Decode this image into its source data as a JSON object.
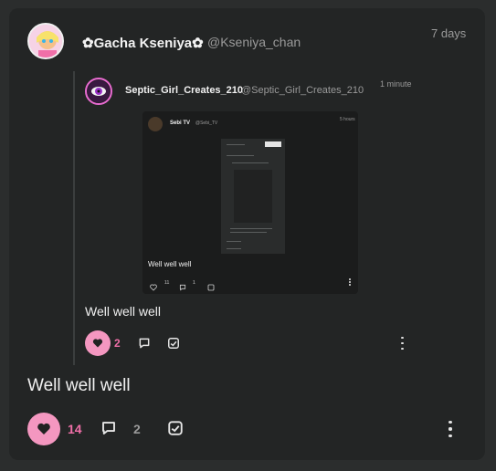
{
  "post": {
    "author_name": "✿Gacha Kseniya✿",
    "handle": "@Kseniya_chan",
    "time": "7 days",
    "text": "Well well well",
    "likes": "14",
    "comments": "2"
  },
  "quoted": {
    "author_name": "Septic_Girl_Creates_210",
    "handle": "@Septic_Girl_Creates_210",
    "time": "1 minute",
    "text": "Well well well",
    "likes": "2"
  },
  "inner": {
    "author_name": "Sebi TV",
    "handle": "@Sebi_TV",
    "time": "5 hours",
    "text": "Well well well",
    "likes": "11",
    "comments": "1"
  },
  "colors": {
    "accent_pink": "#f497c0",
    "like_text": "#f06fa8"
  }
}
